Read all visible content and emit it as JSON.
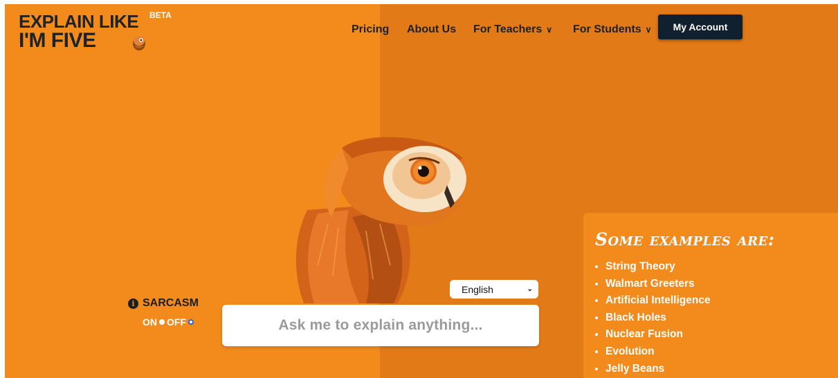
{
  "brand": {
    "logo_line1": "EXPLAIN LIKE",
    "logo_line2": "I'M FIVE",
    "badge": "BETA"
  },
  "nav": {
    "items": [
      {
        "label": "Pricing",
        "has_dropdown": false
      },
      {
        "label": "About Us",
        "has_dropdown": false
      },
      {
        "label": "For Teachers",
        "has_dropdown": true
      },
      {
        "label": "For Students",
        "has_dropdown": true
      }
    ],
    "account_button": "My Account"
  },
  "search": {
    "language": "English",
    "placeholder": "Ask me to explain anything..."
  },
  "sarcasm": {
    "label": "SARCASM",
    "on_label": "ON",
    "off_label": "OFF",
    "selected": "OFF"
  },
  "examples": {
    "heading": "Some examples are:",
    "items": [
      "String Theory",
      "Walmart Greeters",
      "Artificial Intelligence",
      "Black Holes",
      "Nuclear Fusion",
      "Evolution",
      "Jelly Beans"
    ]
  },
  "colors": {
    "primary_orange": "#f28a1c",
    "shaded_orange": "#e27a17",
    "account_button": "#10202f",
    "text_dark": "#1d2126"
  },
  "icons": [
    "owl-illustration",
    "info-icon",
    "chevron-down-icon"
  ]
}
